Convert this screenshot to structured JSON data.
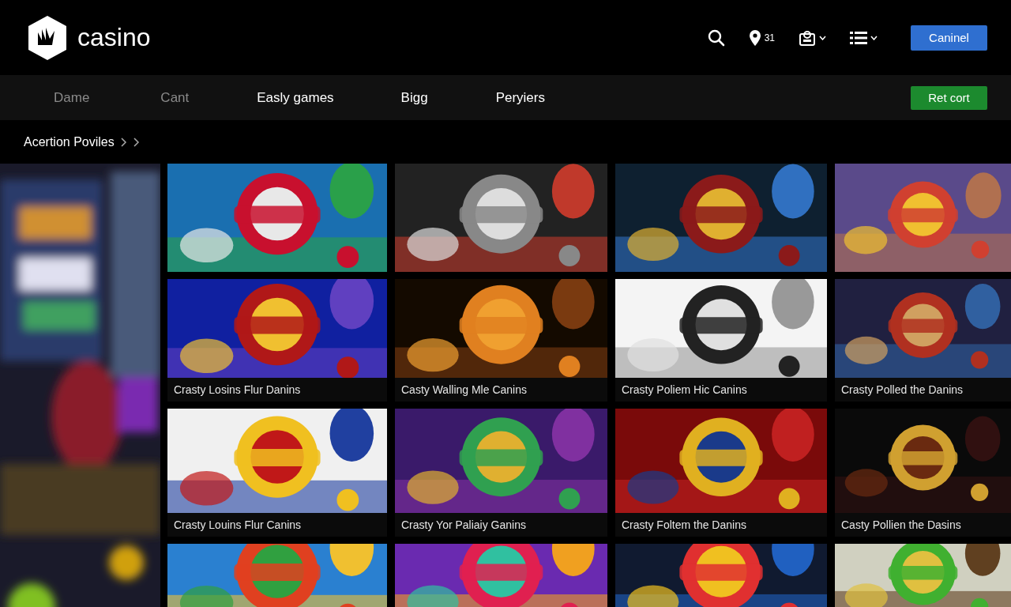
{
  "header": {
    "logo": "casino",
    "location_count": "31",
    "button": "Caninel"
  },
  "nav": {
    "items": [
      {
        "label": "Dame",
        "disabled": true
      },
      {
        "label": "Cant",
        "disabled": true
      },
      {
        "label": "Easly games",
        "disabled": false
      },
      {
        "label": "Bigg",
        "disabled": false
      },
      {
        "label": "Peryiers",
        "disabled": false
      }
    ],
    "button": "Ret cort"
  },
  "breadcrumb": {
    "label": "Acertion Poviles"
  },
  "side": {
    "kind": "picture"
  },
  "tiles": [
    {
      "kind": "picture"
    },
    {
      "kind": "picture"
    },
    {
      "kind": "picture"
    },
    {
      "kind": "picture"
    },
    {
      "kind": "picture",
      "caption": "Crasty Losins Flur Danins"
    },
    {
      "kind": "picture",
      "caption": "Casty Walling Mle Canins"
    },
    {
      "kind": "picture",
      "caption": "Crasty Poliem Hic Canins"
    },
    {
      "kind": "picture",
      "caption": "Crasty Polled the Danins"
    },
    {
      "kind": "picture",
      "caption": "Crasty Louins Flur Canins"
    },
    {
      "kind": "picture",
      "caption": "Crasty Yor Paliaiy Ganins"
    },
    {
      "kind": "picture",
      "caption": "Crasty Foltem the Danins"
    },
    {
      "kind": "picture",
      "caption": "Casty Pollien the Dasins"
    },
    {
      "kind": "picture"
    },
    {
      "kind": "picture"
    },
    {
      "kind": "picture"
    },
    {
      "kind": "picture"
    }
  ]
}
